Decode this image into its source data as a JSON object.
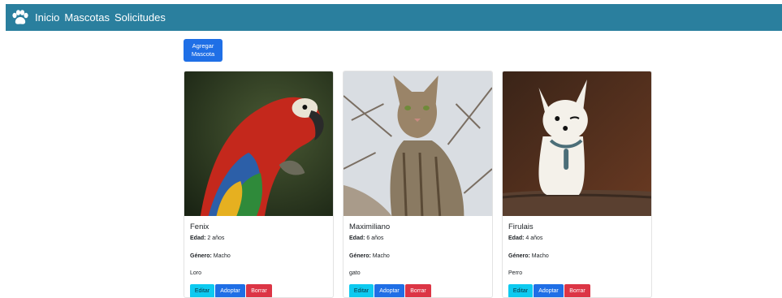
{
  "nav": {
    "brand_icon": "paw-icon",
    "links": [
      "Inicio",
      "Mascotas",
      "Solicitudes"
    ]
  },
  "add_button": {
    "label": "Agregar Mascota"
  },
  "labels": {
    "age": "Edad:",
    "gender": "Género:"
  },
  "buttons": {
    "edit": "Editar",
    "adopt": "Adoptar",
    "delete": "Borrar"
  },
  "pets": [
    {
      "name": "Fenix",
      "age": "2 años",
      "gender": "Macho",
      "kind": "Loro",
      "image": "parrot-photo"
    },
    {
      "name": "Maximiliano",
      "age": "6 años",
      "gender": "Macho",
      "kind": "gato",
      "image": "cat-photo"
    },
    {
      "name": "Firulais",
      "age": "4 años",
      "gender": "Macho",
      "kind": "Perro",
      "image": "dog-photo"
    }
  ],
  "colors": {
    "navbar": "#2a7f9e",
    "primary": "#1f6fe6",
    "info": "#0dcaf0",
    "danger": "#dc3545"
  }
}
